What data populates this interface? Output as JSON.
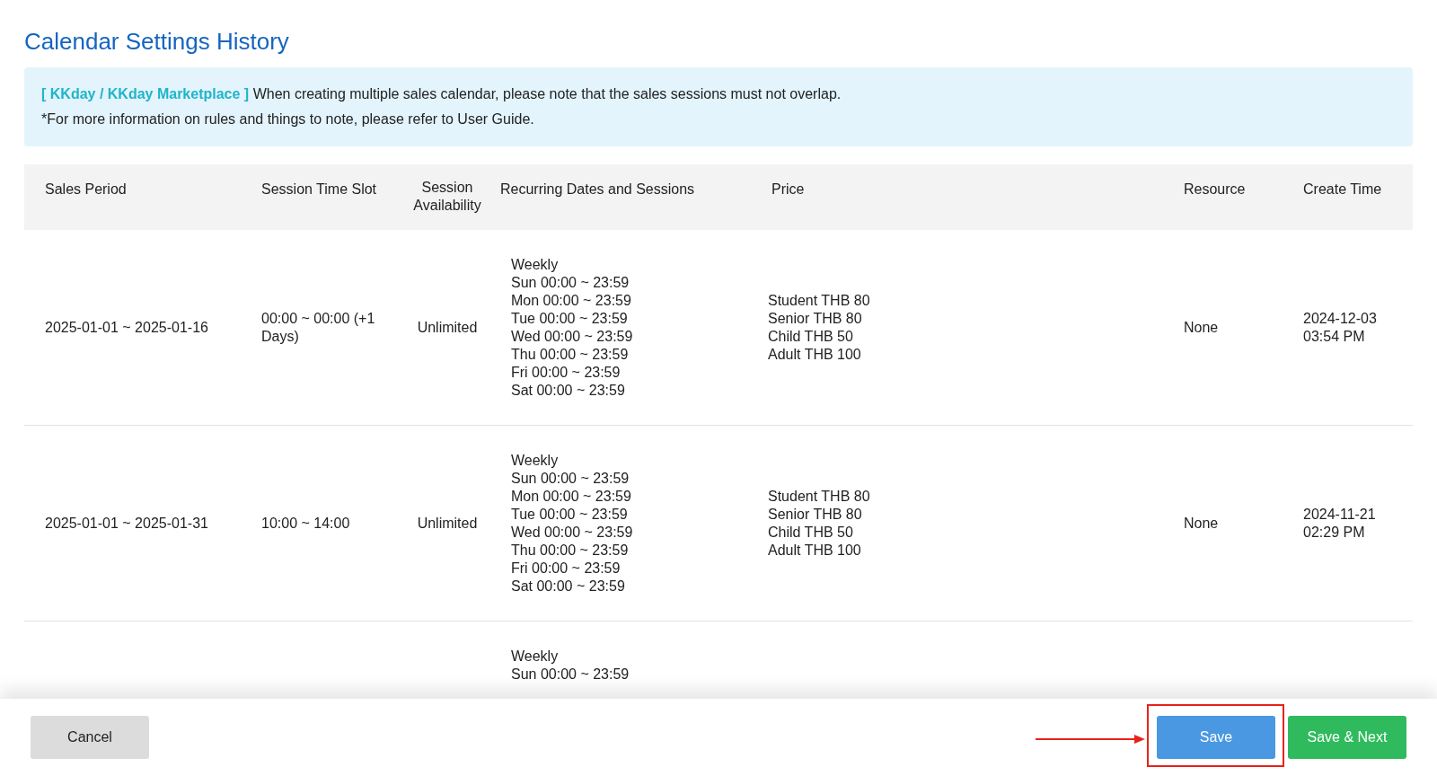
{
  "title": "Calendar Settings History",
  "notice": [
    "**[ KKday / KKday Marketplace ]** When creating multiple sales calendar, please note that the sales sessions must not overlap.",
    "*For more information on rules and things to note, please refer to User Guide."
  ],
  "table": {
    "columns": [
      "Sales Period",
      "Session Time Slot",
      "Session Availability",
      "Recurring Dates and Sessions",
      "Price",
      "Resource",
      "Create Time"
    ],
    "rows": [
      {
        "sales_period": "2025-01-01 ~ 2025-01-16",
        "session_time_slot": "00:00 ~ 00:00 (+1 Days)",
        "session_availability": "Unlimited",
        "recurring": [
          "Weekly",
          "Sun 00:00 ~ 23:59",
          "Mon 00:00 ~ 23:59",
          "Tue 00:00 ~ 23:59",
          "Wed 00:00 ~ 23:59",
          "Thu 00:00 ~ 23:59",
          "Fri 00:00 ~ 23:59",
          "Sat 00:00 ~ 23:59"
        ],
        "price": [
          "Student THB 80",
          "Senior THB 80",
          "Child THB 50",
          "Adult THB 100"
        ],
        "resource": "None",
        "create_time": [
          "2024-12-03",
          "03:54 PM"
        ]
      },
      {
        "sales_period": "2025-01-01 ~ 2025-01-31",
        "session_time_slot": "10:00 ~ 14:00",
        "session_availability": "Unlimited",
        "recurring": [
          "Weekly",
          "Sun 00:00 ~ 23:59",
          "Mon 00:00 ~ 23:59",
          "Tue 00:00 ~ 23:59",
          "Wed 00:00 ~ 23:59",
          "Thu 00:00 ~ 23:59",
          "Fri 00:00 ~ 23:59",
          "Sat 00:00 ~ 23:59"
        ],
        "price": [
          "Student THB 80",
          "Senior THB 80",
          "Child THB 50",
          "Adult THB 100"
        ],
        "resource": "None",
        "create_time": [
          "2024-11-21",
          "02:29 PM"
        ]
      },
      {
        "recurring": [
          "Weekly",
          "Sun 00:00 ~ 23:59"
        ]
      }
    ]
  },
  "buttons": [
    {
      "label": "Cancel",
      "kind": "secondary"
    },
    {
      "label": "Save",
      "kind": "primary",
      "highlighted": true
    },
    {
      "label": "Save & Next",
      "kind": "success",
      "highlighted": false
    }
  ]
}
